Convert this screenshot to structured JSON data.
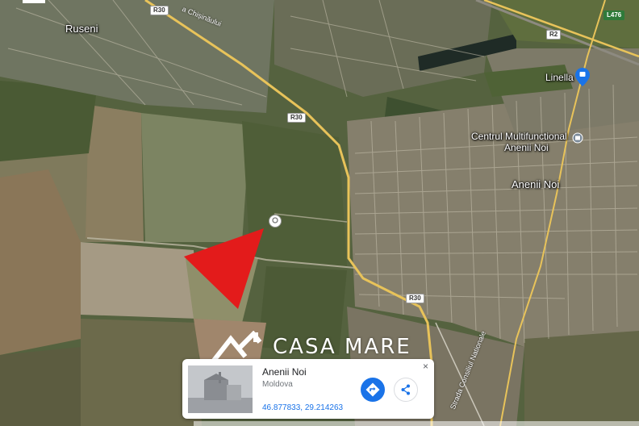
{
  "map": {
    "place_labels": [
      {
        "text": "Ruseni",
        "class": "lbl-town"
      },
      {
        "text": "Linella",
        "class": "lbl-small"
      },
      {
        "text": "Centrul Multifunctional",
        "class": "lbl-small"
      },
      {
        "text": "Anenii Noi",
        "class": "lbl-small"
      },
      {
        "text": "Anenii Noi",
        "class": "lbl-town"
      }
    ],
    "road_shields": {
      "r30_top": "R30",
      "r30_mid": "R30",
      "r30_bottom": "R30",
      "r2": "R2",
      "l476": "L476"
    },
    "streets": {
      "chisinaului": "a Chișinăului",
      "nationale": "Strada Consiliul Nationale"
    }
  },
  "brand": {
    "name": "CASA MARE"
  },
  "info_card": {
    "title": "Anenii Noi",
    "subtitle": "Moldova",
    "coordinates": "46.877833, 29.214263",
    "close_glyph": "×"
  },
  "colors": {
    "marker_arrow": "#e31b1b",
    "directions_button": "#1a73e8",
    "coords_link": "#1a73e8"
  }
}
